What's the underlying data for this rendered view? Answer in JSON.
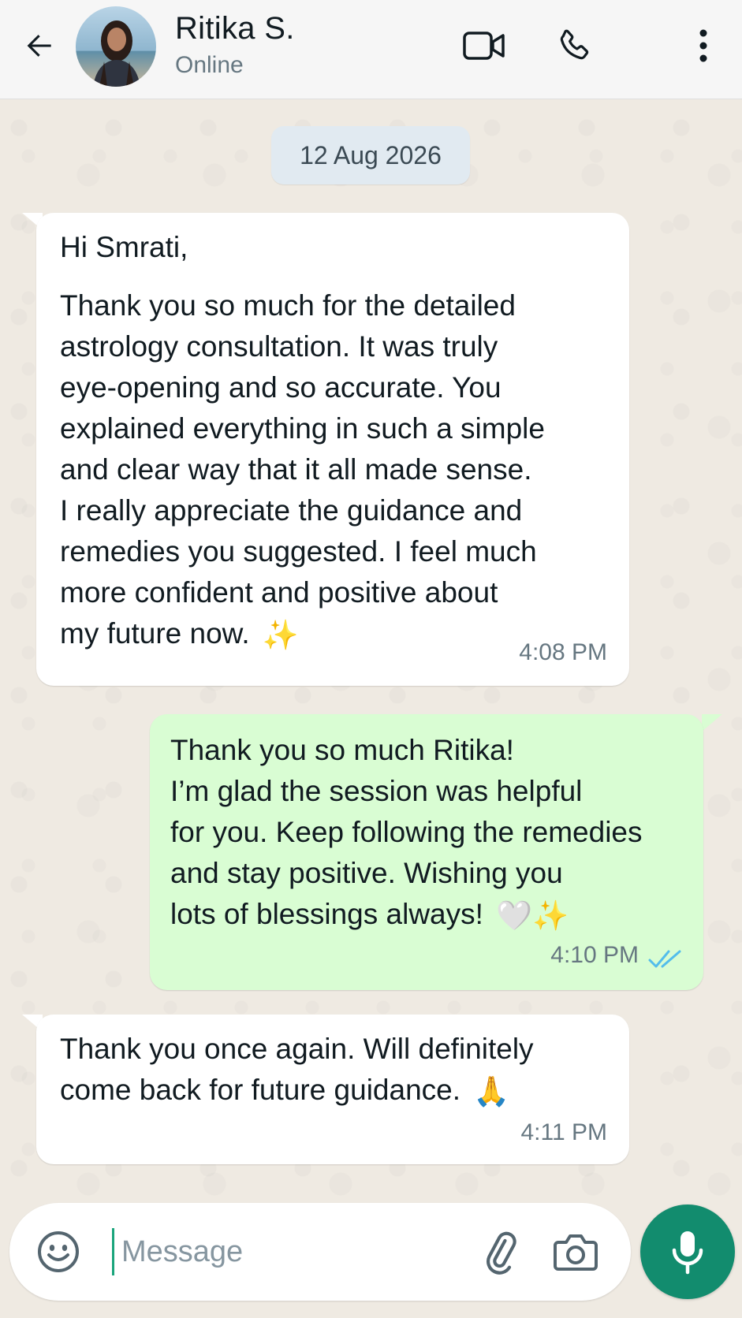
{
  "header": {
    "contact_name": "Ritika S.",
    "status": "Online",
    "icons": [
      "back-arrow-icon",
      "avatar",
      "video-call-icon",
      "voice-call-icon",
      "more-options-icon"
    ]
  },
  "chat": {
    "date_chip": "12 Aug 2026",
    "messages": [
      {
        "direction": "incoming",
        "greeting": "Hi Smrati,",
        "lines": [
          "Thank you so much for the detailed",
          "astrology consultation. It was truly",
          "eye-opening and so accurate. You",
          "explained everything in such a simple",
          "and clear way that it all made sense.",
          "I really appreciate the guidance and",
          "remedies you suggested. I feel much",
          "more confident and positive about",
          "my future now."
        ],
        "emoji": "✨",
        "time": "4:08 PM"
      },
      {
        "direction": "outgoing",
        "lines": [
          "Thank you so much Ritika!",
          "I’m glad the session was helpful",
          "for you. Keep following the remedies",
          "and stay positive. Wishing you",
          "lots of blessings always!"
        ],
        "emoji": "🤍✨",
        "time": "4:10 PM",
        "receipt": "read",
        "receipt_color": "#53bdeb"
      },
      {
        "direction": "incoming",
        "lines": [
          "Thank you once again. Will definitely",
          "come back for future guidance."
        ],
        "emoji": "🙏",
        "time": "4:11 PM"
      }
    ]
  },
  "composer": {
    "placeholder": "Message",
    "value": "",
    "icons": [
      "emoji-icon",
      "attach-icon",
      "camera-icon",
      "mic-icon"
    ],
    "mic_button_color": "#128c6e"
  },
  "colors": {
    "chat_background": "#efeae2",
    "incoming_bubble": "#ffffff",
    "outgoing_bubble": "#d9fdd3",
    "date_chip": "#e1eaf1",
    "accent": "#1aa57c"
  }
}
